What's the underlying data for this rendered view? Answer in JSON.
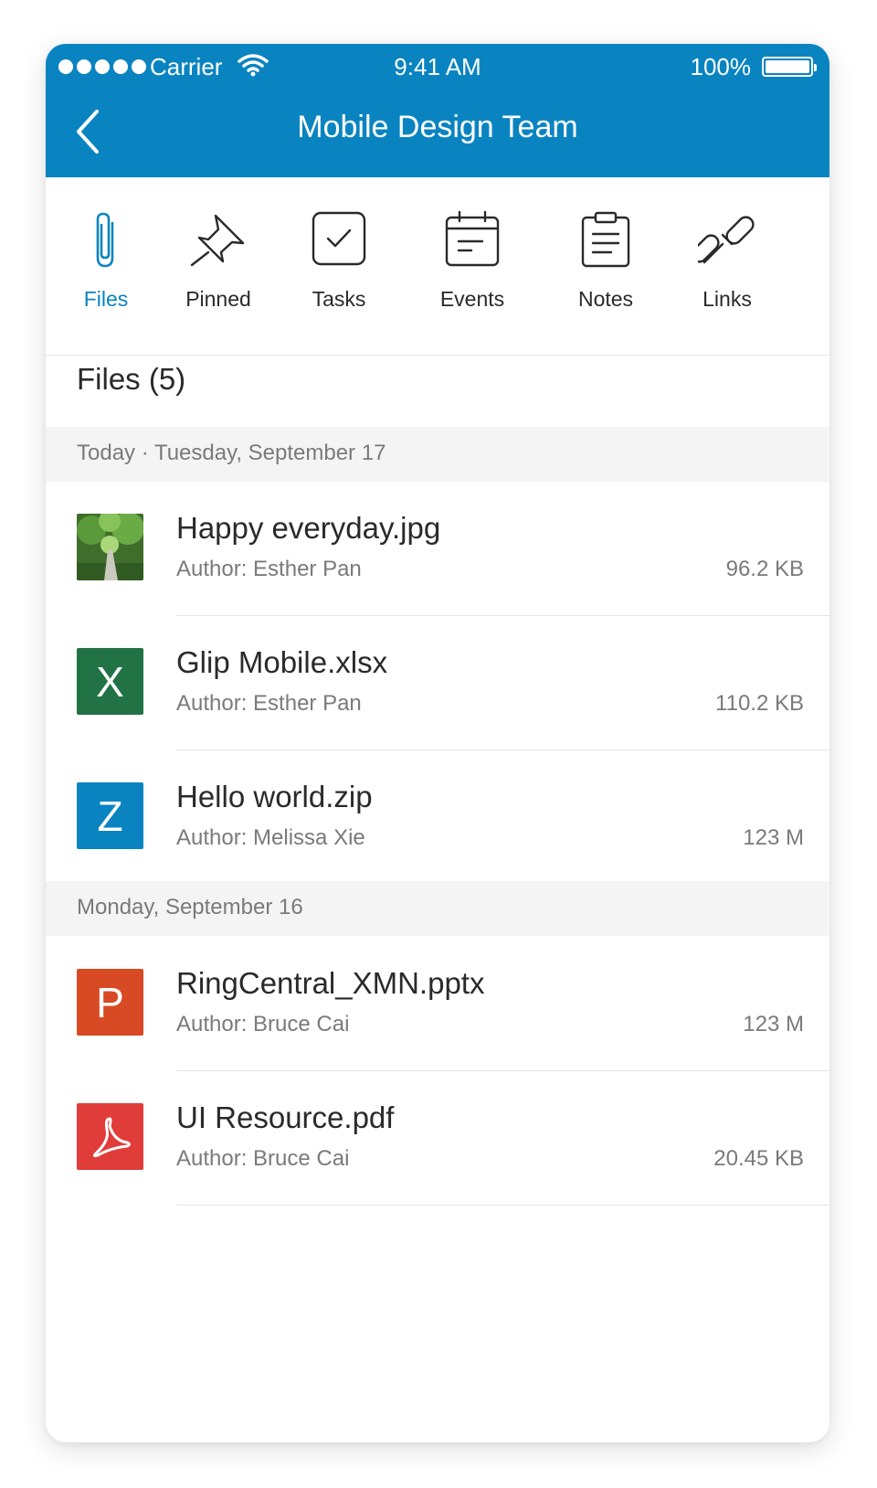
{
  "status": {
    "carrier": "Carrier",
    "time": "9:41 AM",
    "battery": "100%"
  },
  "header": {
    "title": "Mobile Design Team"
  },
  "tabs": [
    {
      "label": "Files",
      "icon": "paperclip-icon",
      "active": true
    },
    {
      "label": "Pinned",
      "icon": "pin-icon"
    },
    {
      "label": "Tasks",
      "icon": "task-check-icon"
    },
    {
      "label": "Events",
      "icon": "calendar-icon"
    },
    {
      "label": "Notes",
      "icon": "notes-icon"
    },
    {
      "label": "Links",
      "icon": "link-icon"
    }
  ],
  "files_title": "Files (5)",
  "groups": [
    {
      "label": "Today · Tuesday, September 17"
    },
    {
      "label": "Monday, September 16"
    }
  ],
  "files": [
    {
      "name": "Happy everyday.jpg",
      "author": "Author: Esther Pan",
      "size": "96.2 KB",
      "type": "image"
    },
    {
      "name": "Glip Mobile.xlsx",
      "author": "Author: Esther Pan",
      "size": "110.2 KB",
      "type": "xlsx",
      "badge": "X",
      "color": "#217346"
    },
    {
      "name": "Hello world.zip",
      "author": "Author: Melissa Xie",
      "size": "123 M",
      "type": "zip",
      "badge": "Z",
      "color": "#0a84c1"
    },
    {
      "name": "RingCentral_XMN.pptx",
      "author": "Author: Bruce Cai",
      "size": "123 M",
      "type": "pptx",
      "badge": "P",
      "color": "#d84a24"
    },
    {
      "name": "UI Resource.pdf",
      "author": "Author: Bruce Cai",
      "size": "20.45 KB",
      "type": "pdf",
      "color": "#e03c3a"
    }
  ],
  "colors": {
    "accent": "#0a84c1",
    "text": "#2a2a2a",
    "muted": "#7a7a7a"
  }
}
